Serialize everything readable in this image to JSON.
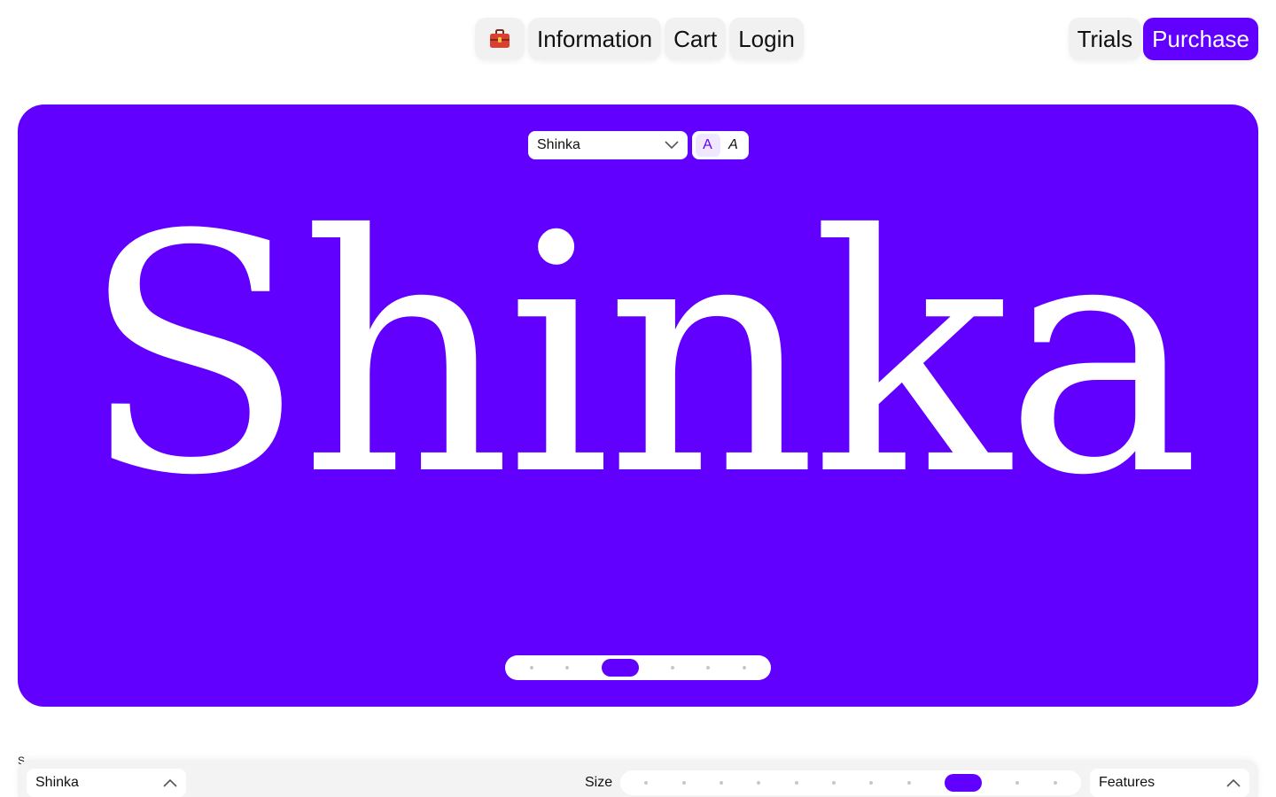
{
  "nav": {
    "toolbox_icon": "toolbox-icon",
    "items": [
      "Information",
      "Cart",
      "Login"
    ],
    "trials_label": "Trials",
    "purchase_label": "Purchase"
  },
  "hero": {
    "font_select": {
      "value": "Shinka",
      "icon": "chevron-down-icon"
    },
    "style_toggle": {
      "regular": "A",
      "italic": "A"
    },
    "specimen_text": "Shinka",
    "slider": {
      "steps": 6,
      "active_index": 2
    }
  },
  "toolbar": {
    "stray_text": "S",
    "font_select": {
      "value": "Shinka",
      "icon": "chevron-up-icon"
    },
    "size_label": "Size",
    "size_slider": {
      "steps": 11,
      "active_index": 8
    },
    "features_select": {
      "value": "Features",
      "icon": "chevron-up-icon"
    }
  },
  "colors": {
    "accent": "#6100ff",
    "pill_bg": "#f1f1f1",
    "toolbar_bg": "#f3f3f3"
  }
}
